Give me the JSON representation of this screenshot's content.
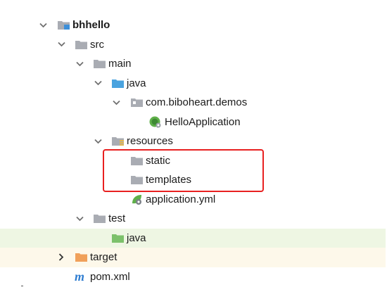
{
  "tree": {
    "project": "bhhello",
    "src": "src",
    "main": "main",
    "java_main": "java",
    "package": "com.biboheart.demos",
    "app_class": "HelloApplication",
    "resources": "resources",
    "static": "static",
    "templates": "templates",
    "app_yml": "application.yml",
    "test": "test",
    "java_test": "java",
    "target": "target",
    "pom": "pom.xml"
  },
  "icons": {
    "folder_gray": "#a9acb3",
    "folder_blue": "#4aa3df",
    "folder_green": "#7cc16b",
    "folder_orange": "#f0a05a",
    "resources_bar": "#e6b84a",
    "project_square": "#3d8fd9",
    "spring_green": "#5fb04a",
    "maven_m": "#2f7dd1"
  },
  "highlight_color": "#e82020"
}
